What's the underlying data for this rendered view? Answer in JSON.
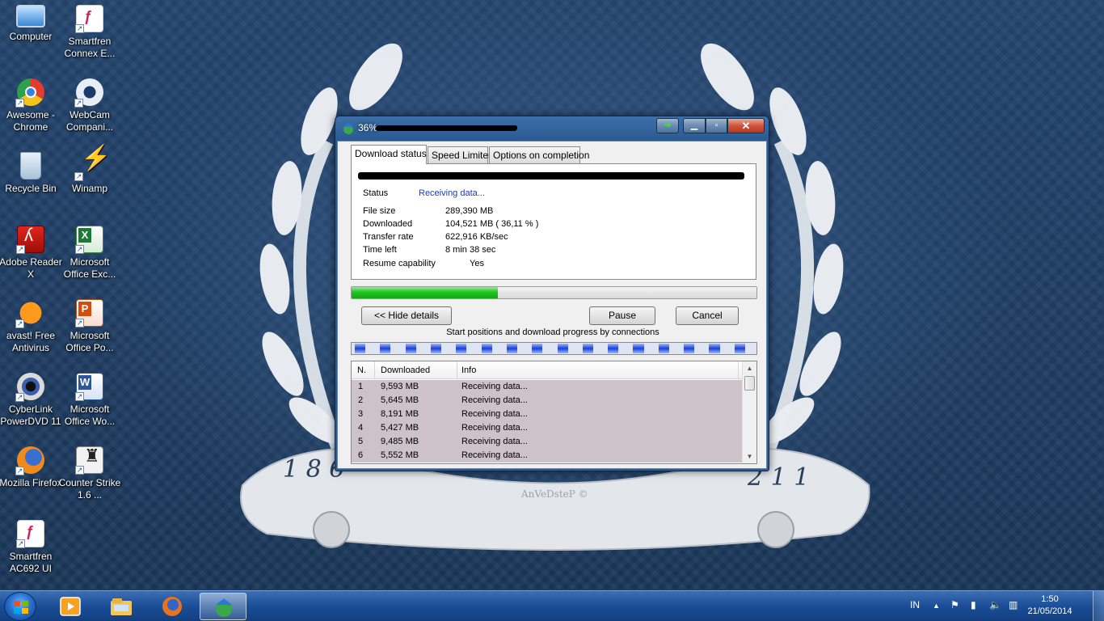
{
  "desktop": {
    "icons": [
      {
        "label": "Computer",
        "icon": "computer-icon"
      },
      {
        "label": "Smartfren Connex E...",
        "icon": "smartfren-icon"
      },
      {
        "label": "Awesome - Chrome",
        "icon": "chrome-icon"
      },
      {
        "label": "WebCam Compani...",
        "icon": "webcam-icon"
      },
      {
        "label": "Recycle Bin",
        "icon": "recycle-bin-icon"
      },
      {
        "label": "Winamp",
        "icon": "winamp-icon"
      },
      {
        "label": "Adobe Reader X",
        "icon": "adobe-reader-icon"
      },
      {
        "label": "Microsoft Office Exc...",
        "icon": "excel-icon"
      },
      {
        "label": "avast! Free Antivirus",
        "icon": "avast-icon"
      },
      {
        "label": "Microsoft Office Po...",
        "icon": "powerpoint-icon"
      },
      {
        "label": "CyberLink PowerDVD 11",
        "icon": "powerdvd-icon"
      },
      {
        "label": "Microsoft Office Wo...",
        "icon": "word-icon"
      },
      {
        "label": "Mozilla Firefox",
        "icon": "firefox-icon"
      },
      {
        "label": "Counter Strike 1.6 ...",
        "icon": "counter-strike-icon"
      },
      {
        "label": "Smartfren AC692 UI",
        "icon": "smartfren-ac692-icon"
      }
    ],
    "wallpaper": {
      "year_left": "1 8 6",
      "year_right": "2 1 1",
      "signature": "AnVeDsteP ©"
    }
  },
  "window": {
    "title": "36%",
    "tabs": [
      {
        "label": "Download status"
      },
      {
        "label": "Speed Limiter"
      },
      {
        "label": "Options on completion"
      }
    ],
    "status_label": "Status",
    "status_value": "Receiving data...",
    "file_size_label": "File size",
    "file_size_value": "289,390  MB",
    "downloaded_label": "Downloaded",
    "downloaded_value": "104,521  MB  ( 36,11 % )",
    "transfer_rate_label": "Transfer rate",
    "transfer_rate_value": "622,916  KB/sec",
    "time_left_label": "Time left",
    "time_left_value": "8 min 38 sec",
    "resume_label": "Resume capability",
    "resume_value": "Yes",
    "progress_fraction": 0.3611,
    "hide_details_label": "<< Hide details",
    "pause_label": "Pause",
    "cancel_label": "Cancel",
    "connections_caption": "Start positions and download progress by connections",
    "connection_segments": 16,
    "list_columns": [
      "N.",
      "Downloaded",
      "Info"
    ],
    "connections": [
      {
        "n": "1",
        "downloaded": "9,593  MB",
        "info": "Receiving data..."
      },
      {
        "n": "2",
        "downloaded": "5,645  MB",
        "info": "Receiving data..."
      },
      {
        "n": "3",
        "downloaded": "8,191  MB",
        "info": "Receiving data..."
      },
      {
        "n": "4",
        "downloaded": "5,427  MB",
        "info": "Receiving data..."
      },
      {
        "n": "5",
        "downloaded": "9,485  MB",
        "info": "Receiving data..."
      },
      {
        "n": "6",
        "downloaded": "5,552  MB",
        "info": "Receiving data..."
      }
    ]
  },
  "taskbar": {
    "apps": [
      {
        "name": "media-player-icon"
      },
      {
        "name": "explorer-icon"
      },
      {
        "name": "firefox-icon"
      },
      {
        "name": "idm-icon",
        "active": true
      }
    ],
    "tray_language": "IN",
    "clock_time": "1:50",
    "clock_date": "21/05/2014"
  },
  "colors": {
    "progress_green": "#22c322",
    "segment_blue": "#1d3fd6",
    "list_row_bg": "#cdc2c8",
    "status_value_blue": "#1f3bb0"
  }
}
